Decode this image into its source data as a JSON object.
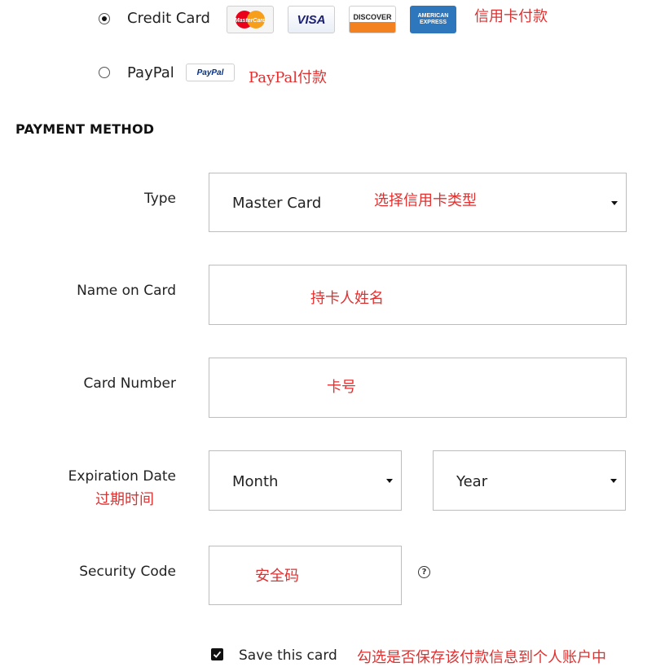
{
  "payment_options": {
    "credit_card": {
      "label": "Credit Card",
      "selected": true,
      "annotation": "信用卡付款"
    },
    "paypal": {
      "label": "PayPal",
      "selected": false,
      "annotation": "PayPal付款"
    },
    "logos": {
      "mastercard": "MasterCard",
      "visa": "VISA",
      "discover": "DISCOVER",
      "amex_line1": "AMERICAN",
      "amex_line2": "EXPRESS",
      "paypal": "PayPal"
    }
  },
  "section": {
    "title": "PAYMENT METHOD"
  },
  "form": {
    "type": {
      "label": "Type",
      "value": "Master Card",
      "annotation": "选择信用卡类型"
    },
    "name_on_card": {
      "label": "Name on Card",
      "annotation": "持卡人姓名"
    },
    "card_number": {
      "label": "Card Number",
      "annotation": "卡号"
    },
    "expiration": {
      "label": "Expiration Date",
      "annotation": "过期时间",
      "month": "Month",
      "year": "Year"
    },
    "security_code": {
      "label": "Security Code",
      "annotation": "安全码",
      "help_icon": "question-circle-icon"
    },
    "save_card": {
      "label": "Save this card",
      "checked": true,
      "annotation": "勾选是否保存该付款信息到个人账户中"
    }
  },
  "colors": {
    "annotation": "#e0302f",
    "border": "#bdbdbd",
    "mastercard_red": "#eb001b",
    "mastercard_orange": "#f79e1b",
    "visa_blue": "#1a1f71",
    "discover_orange": "#f48120",
    "amex_blue": "#2e77bc"
  }
}
